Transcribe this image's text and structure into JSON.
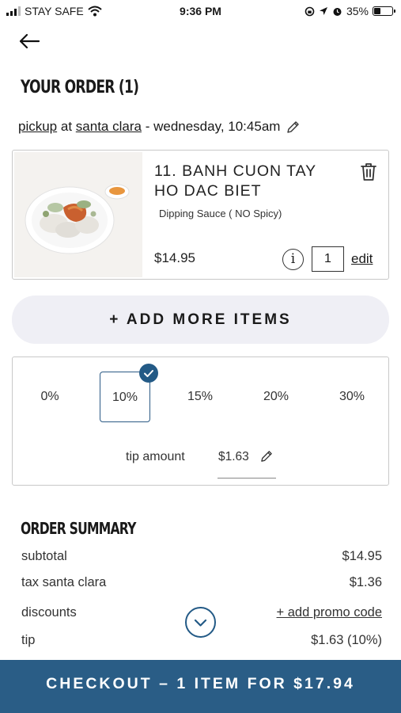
{
  "status_bar": {
    "carrier": "STAY SAFE",
    "time": "9:36 PM",
    "battery": "35%",
    "battery_level": 0.35
  },
  "header": {
    "title": "YOUR ORDER (1)"
  },
  "order_info": {
    "method": "pickup",
    "at": "at",
    "location": "santa clara",
    "time": "- wednesday, 10:45am"
  },
  "item": {
    "name": "11. BANH CUON TAY HO DAC BIET",
    "option": "Dipping Sauce ( NO Spicy)",
    "price": "$14.95",
    "info_glyph": "i",
    "quantity": "1",
    "edit_label": "edit"
  },
  "add_more": {
    "label": "+ ADD MORE ITEMS"
  },
  "tip": {
    "options": [
      "0%",
      "10%",
      "15%",
      "20%",
      "30%"
    ],
    "selected": "10%",
    "amount_label": "tip amount",
    "amount_value": "$1.63"
  },
  "summary": {
    "title": "ORDER SUMMARY",
    "subtotal_label": "subtotal",
    "subtotal_value": "$14.95",
    "tax_label": "tax santa clara",
    "tax_value": "$1.36",
    "discounts_label": "discounts",
    "promo_label": "+ add promo code",
    "tip_label": "tip",
    "tip_value": "$1.63 (10%)"
  },
  "checkout": {
    "label": "CHECKOUT – 1 ITEM FOR $17.94"
  },
  "colors": {
    "accent": "#2a5d86",
    "add_more_bg": "#efeff5",
    "border": "#c8c8c8"
  },
  "icons": [
    "signal-icon",
    "wifi-icon",
    "location-icon",
    "alarm-icon",
    "battery-icon",
    "back-arrow-icon",
    "pencil-icon",
    "trash-icon",
    "info-icon",
    "check-icon",
    "chevron-down-icon"
  ]
}
